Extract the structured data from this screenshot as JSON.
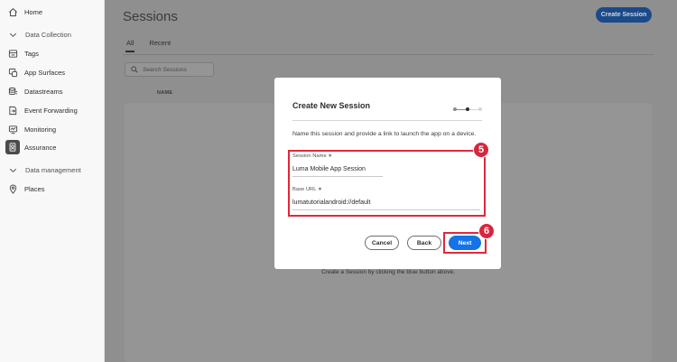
{
  "sidebar": {
    "items": [
      {
        "label": "Home",
        "icon": "home-icon"
      },
      {
        "label": "Data Collection",
        "icon": "chevron-down-icon"
      },
      {
        "label": "Tags",
        "icon": "tags-icon"
      },
      {
        "label": "App Surfaces",
        "icon": "app-surfaces-icon"
      },
      {
        "label": "Datastreams",
        "icon": "datastreams-icon"
      },
      {
        "label": "Event Forwarding",
        "icon": "event-forwarding-icon"
      },
      {
        "label": "Monitoring",
        "icon": "monitoring-icon"
      },
      {
        "label": "Assurance",
        "icon": "assurance-icon"
      },
      {
        "label": "Data management",
        "icon": "chevron-down-icon"
      },
      {
        "label": "Places",
        "icon": "location-pin-icon"
      }
    ],
    "active": "Assurance"
  },
  "main": {
    "title": "Sessions",
    "create_button": "Create Session",
    "tabs": [
      {
        "label": "All",
        "selected": true
      },
      {
        "label": "Recent",
        "selected": false
      }
    ],
    "search_placeholder": "Search Sessions",
    "column_header": "NAME",
    "empty_message": "Create a Session by clicking the blue button above."
  },
  "modal": {
    "title": "Create New Session",
    "description": "Name this session and provide a link to launch the app on a device.",
    "fields": [
      {
        "label": "Session Name ∗",
        "value": "Luma Mobile App Session"
      },
      {
        "label": "Base URL ∗",
        "value": "lumatutorialandroid://default"
      }
    ],
    "buttons": {
      "cancel": "Cancel",
      "back": "Back",
      "next": "Next"
    },
    "steps_total": 3,
    "current_step": 2
  },
  "callouts": [
    "5",
    "6"
  ],
  "colors": {
    "accent": "#1473e6",
    "highlight": "#e0283a",
    "badge": "#d7263d",
    "sidebar_active": "#4b4b4b"
  }
}
